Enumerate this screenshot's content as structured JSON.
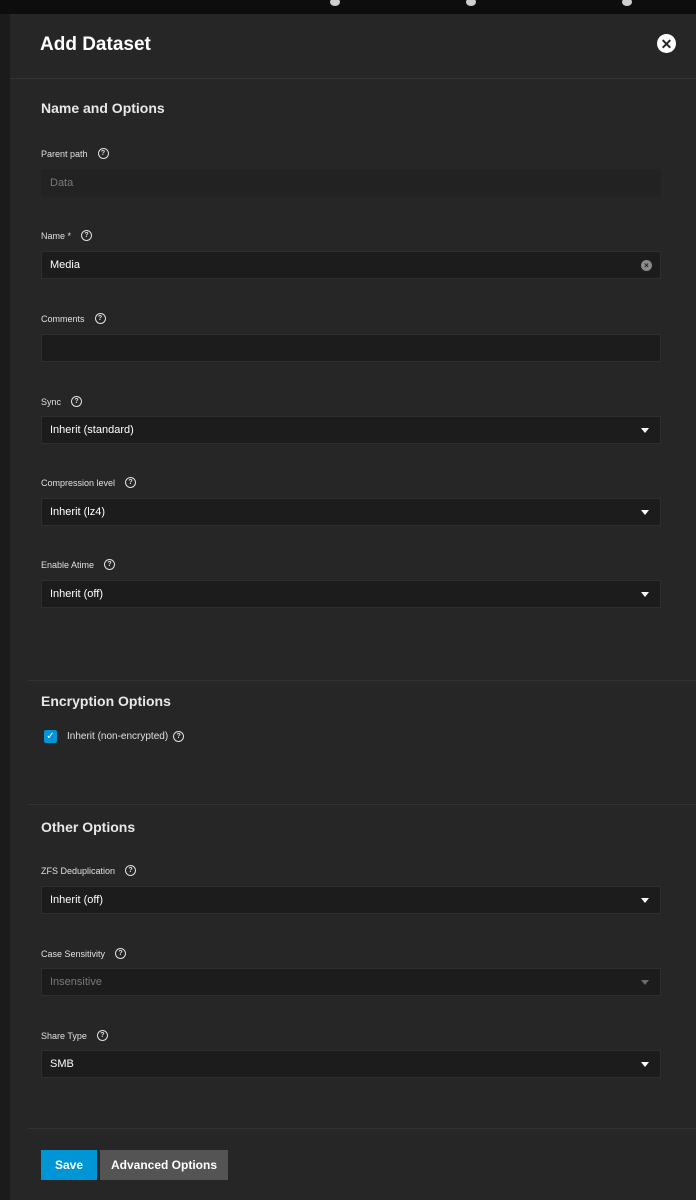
{
  "dialog": {
    "title": "Add Dataset"
  },
  "sections": {
    "name_options": "Name and Options",
    "encryption_options": "Encryption Options",
    "other_options": "Other Options"
  },
  "fields": {
    "parent_path": {
      "label": "Parent path",
      "value": "Data"
    },
    "name": {
      "label": "Name *",
      "value": "Media"
    },
    "comments": {
      "label": "Comments",
      "value": ""
    },
    "sync": {
      "label": "Sync",
      "value": "Inherit (standard)"
    },
    "compression": {
      "label": "Compression level",
      "value": "Inherit (lz4)"
    },
    "atime": {
      "label": "Enable Atime",
      "value": "Inherit (off)"
    },
    "encryption_inherit": {
      "label": "Inherit (non-encrypted)",
      "checked": true
    },
    "deduplication": {
      "label": "ZFS Deduplication",
      "value": "Inherit (off)"
    },
    "case_sensitivity": {
      "label": "Case Sensitivity",
      "value": "Insensitive"
    },
    "share_type": {
      "label": "Share Type",
      "value": "SMB"
    }
  },
  "buttons": {
    "save": "Save",
    "advanced": "Advanced Options"
  },
  "colors": {
    "accent": "#0095d5",
    "panel_bg": "#262626",
    "input_bg": "#1c1c1c",
    "secondary_button": "#545454"
  },
  "icons": {
    "close": "close-icon",
    "help": "help-circle-icon",
    "clear": "clear-input-icon",
    "dropdown": "chevron-down-icon",
    "check": "check-icon"
  }
}
